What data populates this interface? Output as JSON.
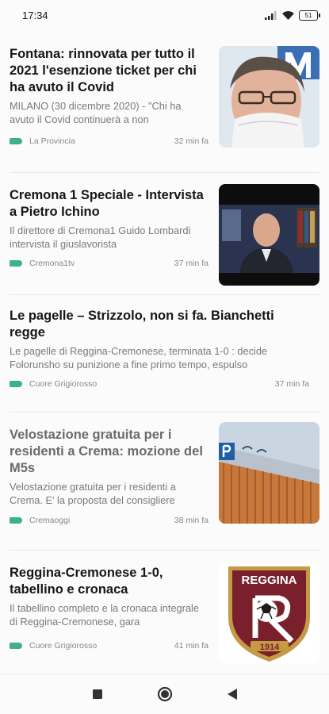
{
  "status": {
    "time": "17:34",
    "battery": "51"
  },
  "articles": [
    {
      "title": "Fontana: rinnovata per tutto il 2021 l'esenzione ticket per chi ha avuto il Covid",
      "snippet": "MILANO (30 dicembre 2020) - \"Chi ha avuto il Covid continuerà a non",
      "source": "La Provincia",
      "time": "32 min fa",
      "thumbnail": "portrait-man-mask",
      "read": false
    },
    {
      "title": "Cremona 1 Speciale - Intervista a Pietro Ichino",
      "snippet": "Il direttore di Cremona1 Guido Lombardi intervista il giuslavorista",
      "source": "Cremona1tv",
      "time": "37 min fa",
      "thumbnail": "video-interview",
      "read": false
    },
    {
      "title": "Le pagelle – Strizzolo, non si fa. Bianchetti regge",
      "snippet": "Le pagelle di Reggina-Cremonese, terminata 1-0 : decide Folorunsho su punizione a fine primo tempo, espulso",
      "source": "Cuore Grigiorosso",
      "time": "37 min fa",
      "thumbnail": null,
      "read": false
    },
    {
      "title": "Velostazione gratuita per i residenti a Crema: mozione del M5s",
      "snippet": "Velostazione gratuita per i residenti a Crema. E' la proposta del consigliere",
      "source": "Cremaoggi",
      "time": "38 min fa",
      "thumbnail": "bike-station-building",
      "read": true
    },
    {
      "title": "Reggina-Cremonese 1-0, tabellino e cronaca",
      "snippet": "Il tabellino completo e la cronaca integrale di Reggina-Cremonese, gara",
      "source": "Cuore Grigiorosso",
      "time": "41 min fa",
      "thumbnail": "reggina-crest",
      "read": false
    }
  ],
  "crest": {
    "name": "REGGINA",
    "year": "1914",
    "color": "#7a1f2c"
  },
  "colors": {
    "tag": "#3fb189"
  },
  "nav": {
    "icons": [
      "recent-apps-icon",
      "home-icon",
      "back-icon"
    ]
  }
}
